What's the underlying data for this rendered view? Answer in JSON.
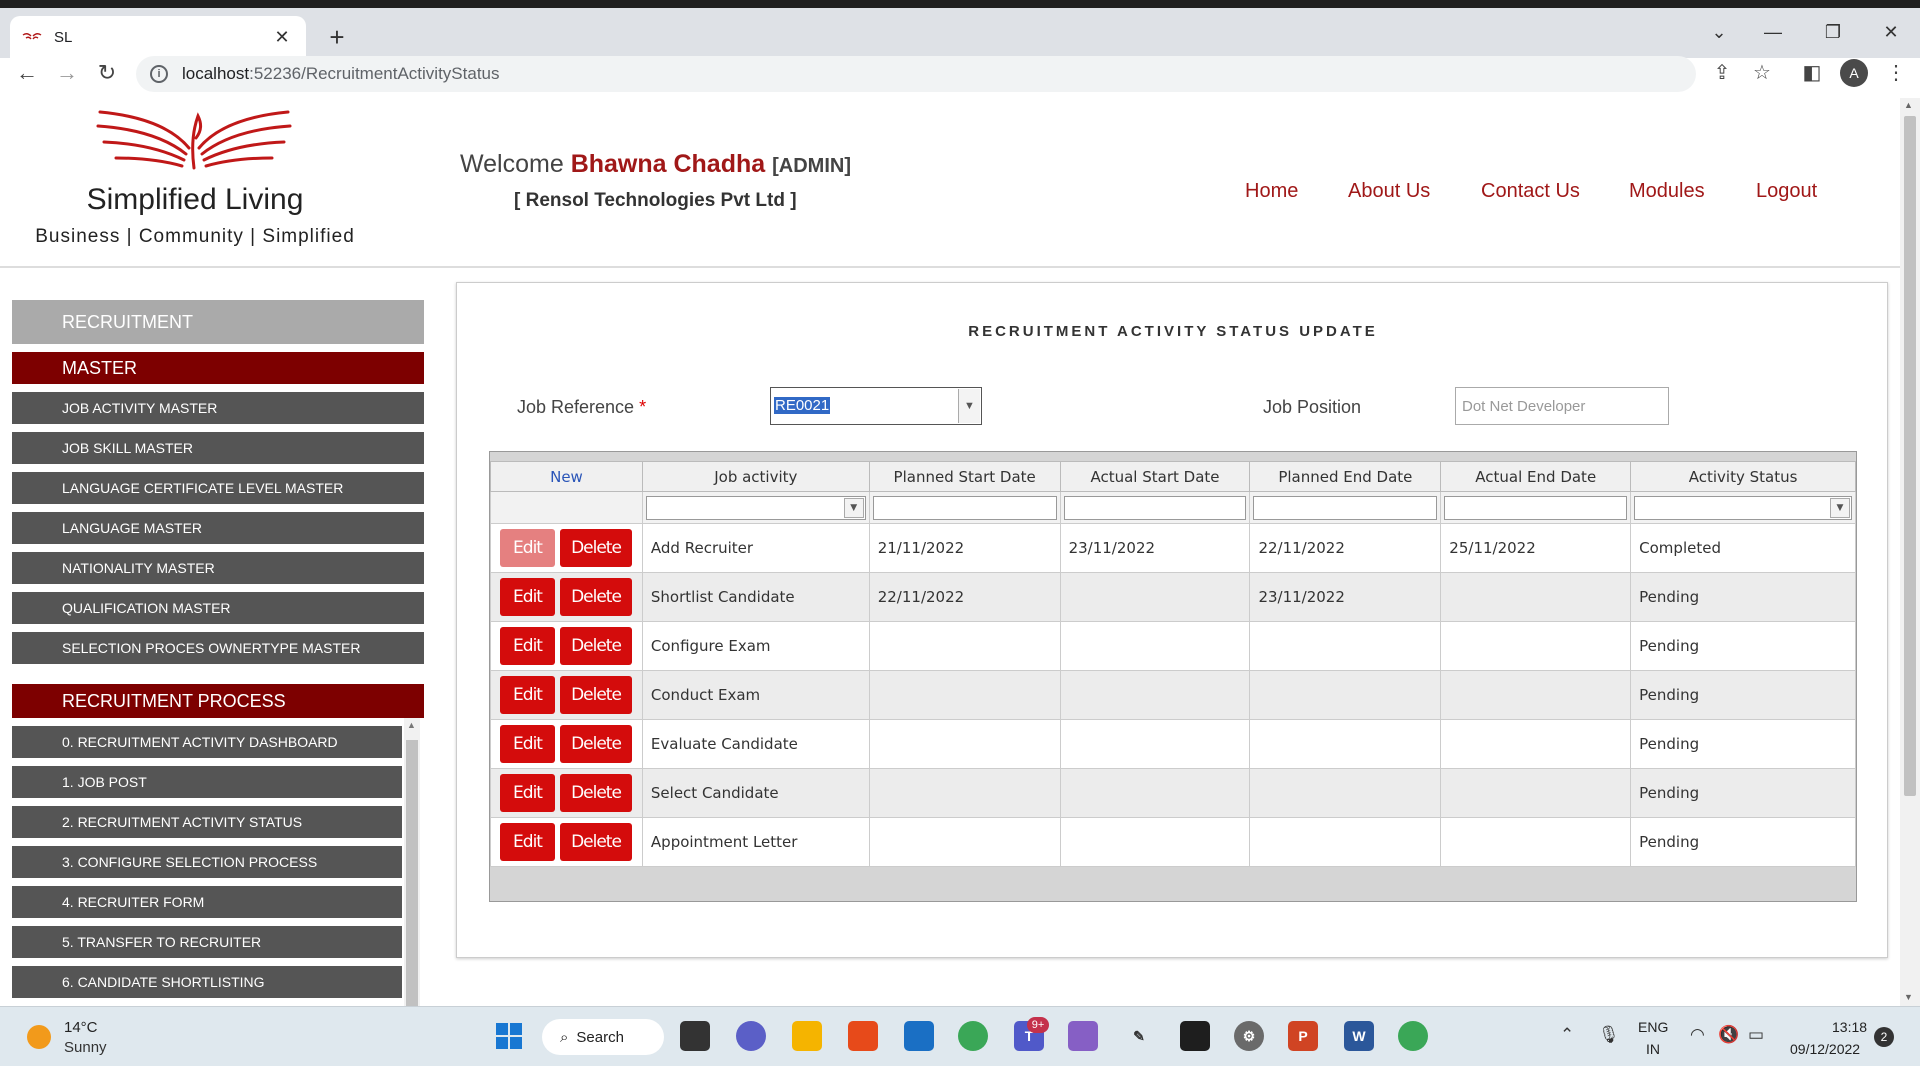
{
  "browser": {
    "tab_title": "SL",
    "url_host": "localhost",
    "url_rest": ":52236/RecruitmentActivityStatus"
  },
  "header": {
    "brand_name": "Simplified Living",
    "tagline": "Business | Community | Simplified",
    "welcome_prefix": "Welcome ",
    "user_name": "Bhawna Chadha",
    "role": "[ADMIN]",
    "company": "[ Rensol Technologies Pvt Ltd ]",
    "nav": [
      "Home",
      "About Us",
      "Contact Us",
      "Modules",
      "Logout"
    ]
  },
  "sidebar": {
    "section": "RECRUITMENT",
    "master_heading": "MASTER",
    "master_items": [
      "JOB ACTIVITY MASTER",
      "JOB SKILL MASTER",
      "LANGUAGE CERTIFICATE LEVEL MASTER",
      "LANGUAGE MASTER",
      "NATIONALITY MASTER",
      "QUALIFICATION MASTER",
      "SELECTION PROCES OWNERTYPE MASTER"
    ],
    "process_heading": "RECRUITMENT PROCESS",
    "process_items": [
      "0. RECRUITMENT ACTIVITY DASHBOARD",
      "1. JOB POST",
      "2. RECRUITMENT ACTIVITY STATUS",
      "3. CONFIGURE SELECTION PROCESS",
      "4. RECRUITER FORM",
      "5. TRANSFER TO RECRUITER",
      "6. CANDIDATE SHORTLISTING"
    ]
  },
  "main": {
    "title": "RECRUITMENT ACTIVITY STATUS UPDATE",
    "job_reference_label": "Job Reference ",
    "required_mark": "*",
    "job_reference_value": "RE0021",
    "job_position_label": "Job Position",
    "job_position_placeholder": "Dot Net Developer",
    "grid": {
      "columns": [
        "New",
        "Job activity",
        "Planned Start Date",
        "Actual Start Date",
        "Planned End Date",
        "Actual End Date",
        "Activity Status"
      ],
      "edit_label": "Edit",
      "delete_label": "Delete",
      "rows": [
        {
          "activity": "Add Recruiter",
          "planned_start": "21/11/2022",
          "actual_start": "23/11/2022",
          "planned_end": "22/11/2022",
          "actual_end": "25/11/2022",
          "status": "Completed"
        },
        {
          "activity": "Shortlist Candidate",
          "planned_start": "22/11/2022",
          "actual_start": "",
          "planned_end": "23/11/2022",
          "actual_end": "",
          "status": "Pending"
        },
        {
          "activity": "Configure Exam",
          "planned_start": "",
          "actual_start": "",
          "planned_end": "",
          "actual_end": "",
          "status": "Pending"
        },
        {
          "activity": "Conduct Exam",
          "planned_start": "",
          "actual_start": "",
          "planned_end": "",
          "actual_end": "",
          "status": "Pending"
        },
        {
          "activity": "Evaluate Candidate",
          "planned_start": "",
          "actual_start": "",
          "planned_end": "",
          "actual_end": "",
          "status": "Pending"
        },
        {
          "activity": "Select Candidate",
          "planned_start": "",
          "actual_start": "",
          "planned_end": "",
          "actual_end": "",
          "status": "Pending"
        },
        {
          "activity": "Appointment Letter",
          "planned_start": "",
          "actual_start": "",
          "planned_end": "",
          "actual_end": "",
          "status": "Pending"
        }
      ]
    }
  },
  "taskbar": {
    "temperature": "14°C",
    "weather": "Sunny",
    "search_label": "Search",
    "teams_badge": "9+",
    "lang_top": "ENG",
    "lang_bottom": "IN",
    "time": "13:18",
    "date": "09/12/2022",
    "notifications": "2"
  },
  "colors": {
    "brand_red": "#a01818",
    "sidebar_heading": "#7d0000",
    "sidebar_item": "#555555",
    "button_red": "#d40c0c"
  }
}
